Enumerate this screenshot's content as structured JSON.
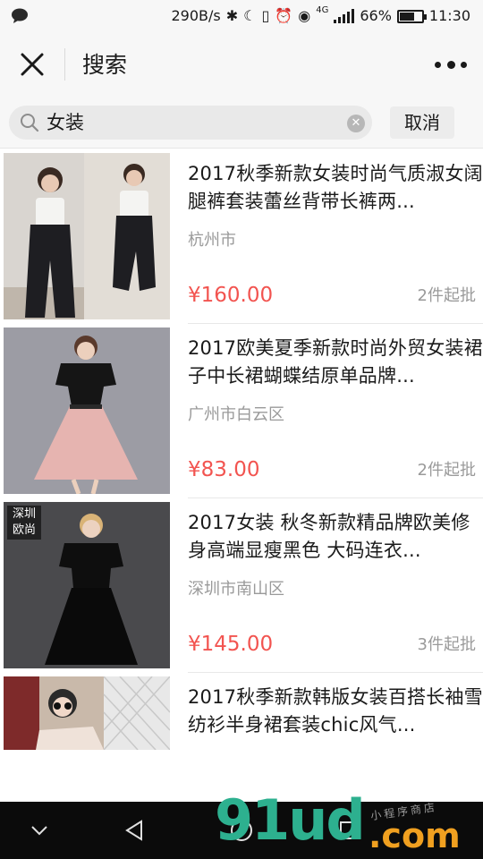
{
  "status_bar": {
    "network_speed": "290B/s",
    "network_type": "4G",
    "battery": "66%",
    "battery_level": 0.66,
    "time": "11:30",
    "icons": [
      "chat-bubble-icon",
      "bluetooth-icon",
      "moon-icon",
      "vibrate-icon",
      "alarm-icon",
      "eye-icon",
      "signal-icon",
      "battery-icon"
    ]
  },
  "nav": {
    "title": "搜索",
    "close_icon": "close-icon",
    "more_icon": "more-dots-icon"
  },
  "search": {
    "query": "女装",
    "clear_icon": "clear-icon",
    "cancel_label": "取消"
  },
  "results": [
    {
      "title": "2017秋季新款女装时尚气质淑女阔腿裤套装蕾丝背带长裤两...",
      "location": "杭州市",
      "price": "¥160.00",
      "moq": "2件起批",
      "badge": ""
    },
    {
      "title": "2017欧美夏季新款时尚外贸女装裙子中长裙蝴蝶结原单品牌...",
      "location": "广州市白云区",
      "price": "¥83.00",
      "moq": "2件起批",
      "badge": ""
    },
    {
      "title": "2017女装 秋冬新款精品牌欧美修身高端显瘦黑色 大码连衣...",
      "location": "深圳市南山区",
      "price": "¥145.00",
      "moq": "3件起批",
      "badge": "深圳 欧尚"
    },
    {
      "title": "2017秋季新款韩版女装百搭长袖雪纺衫半身裙套装chic风气...",
      "location": "",
      "price": "",
      "moq": "",
      "badge": ""
    }
  ],
  "system_nav": {
    "icons": [
      "back-chevron-icon",
      "back-triangle-icon",
      "home-circle-icon",
      "recents-square-icon"
    ]
  },
  "watermark": {
    "brand": "91ud",
    "suffix": ".com",
    "tagline": "小程序商店"
  },
  "colors": {
    "price": "#f25450",
    "accent_watermark": "#2db08f",
    "bar_bg": "#f7f7f7"
  }
}
